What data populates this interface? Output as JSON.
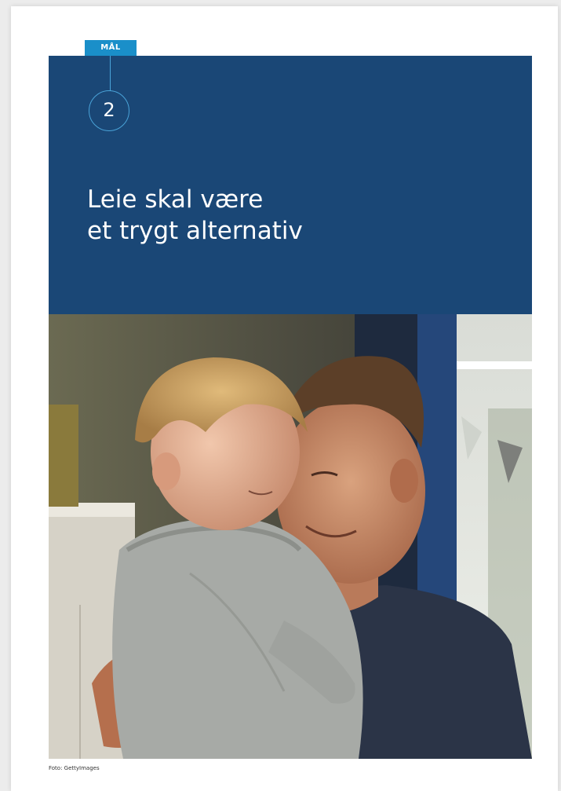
{
  "goal": {
    "tag_label": "MÅL",
    "number": "2"
  },
  "title": {
    "line1": "Leie skal være",
    "line2": "et trygt alternativ"
  },
  "photo": {
    "credit": "Foto: GettyImages"
  },
  "colors": {
    "banner": "#1a4776",
    "tag": "#1a8fc9",
    "accent_line": "#4aa3d8",
    "page": "#ffffff",
    "background": "#ececec"
  }
}
